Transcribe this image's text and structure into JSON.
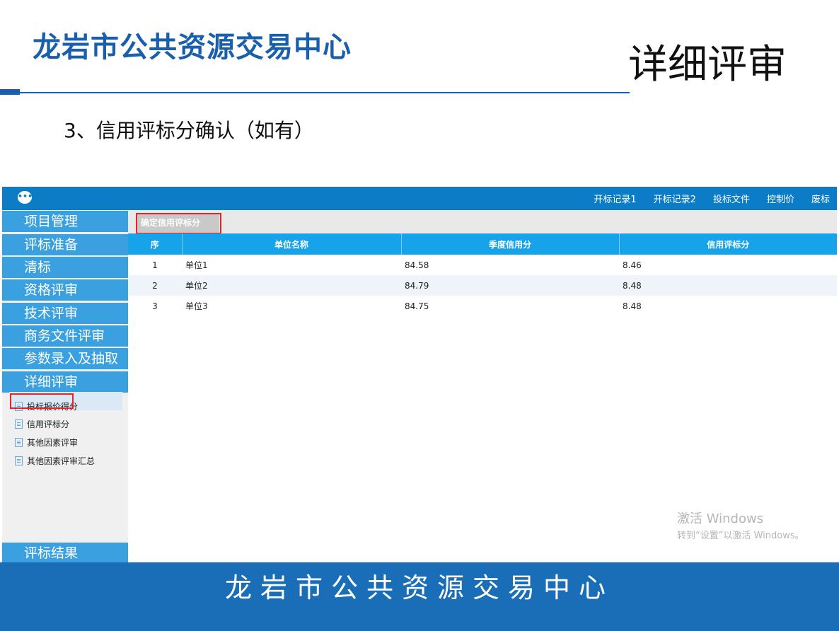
{
  "slide": {
    "org_title": "龙岩市公共资源交易中心",
    "title": "详细评审",
    "subtitle": "3、信用评标分确认（如有）",
    "footer": "龙岩市公共资源交易中心"
  },
  "topbar": {
    "logo_icon": "chat-bubble-icon",
    "nav": [
      "开标记录1",
      "开标记录2",
      "投标文件",
      "控制价",
      "废标"
    ]
  },
  "sidebar": {
    "menu": [
      "项目管理",
      "评标准备",
      "清标",
      "资格评审",
      "技术评审",
      "商务文件评审",
      "参数录入及抽取",
      "详细评审"
    ],
    "sub_items": [
      "投标报价得分",
      "信用评标分",
      "其他因素评审",
      "其他因素评审汇总"
    ],
    "active_sub": "信用评标分",
    "bottom_menu": "评标结果"
  },
  "toolbar": {
    "confirm_label": "确定信用评标分"
  },
  "table": {
    "headers": [
      "序",
      "单位名称",
      "季度信用分",
      "信用评标分"
    ],
    "rows": [
      [
        "1",
        "单位1",
        "84.58",
        "8.46"
      ],
      [
        "2",
        "单位2",
        "84.79",
        "8.48"
      ],
      [
        "3",
        "单位3",
        "84.75",
        "8.48"
      ]
    ]
  },
  "watermark": {
    "line1": "激活 Windows",
    "line2": "转到“设置”以激活 Windows。"
  },
  "colors": {
    "brand_blue": "#1a5fae",
    "topbar_blue": "#0d7cc7",
    "menu_blue": "#3aa0df",
    "header_blue": "#16a3ea",
    "highlight_red": "#e0252b"
  }
}
